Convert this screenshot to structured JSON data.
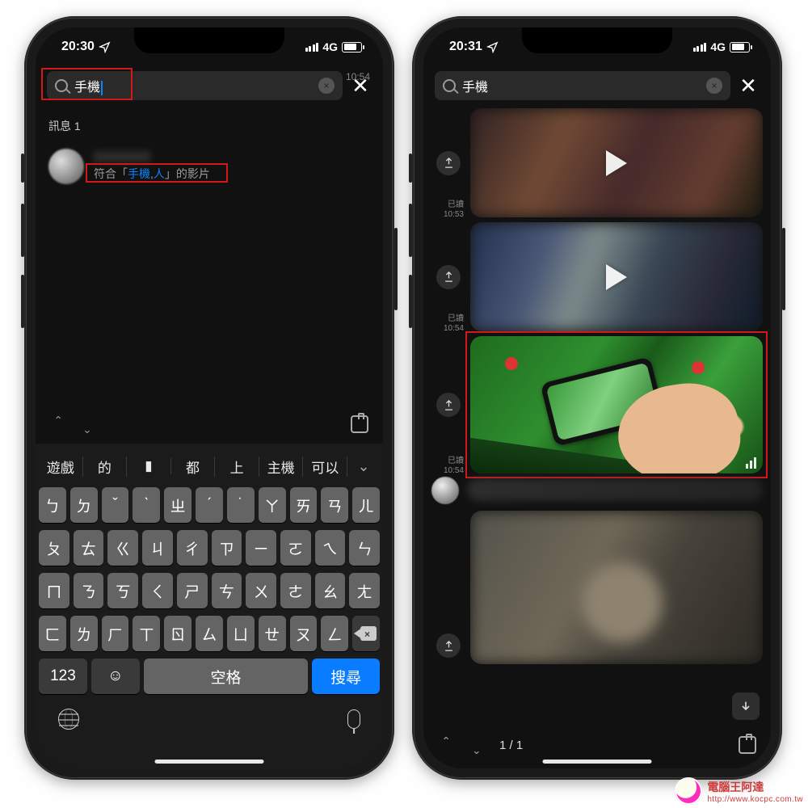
{
  "status": {
    "time_left": "20:30",
    "time_right": "20:31",
    "net": "4G"
  },
  "search": {
    "query": "手機",
    "clear": "×",
    "close": "✕"
  },
  "left": {
    "section": "訊息 1",
    "result": {
      "time": "10:54",
      "pre": "符合「",
      "hl1": "手機",
      "mid": ",",
      "hl2": "人",
      "post": "」的影片"
    },
    "suggestions": [
      "遊戲",
      "的",
      "▮",
      "都",
      "上",
      "主機",
      "可以"
    ],
    "rows": [
      [
        "ㄅ",
        "ㄉ",
        "ˇ",
        "ˋ",
        "ㄓ",
        "ˊ",
        "˙",
        "ㄚ",
        "ㄞ",
        "ㄢ",
        "ㄦ"
      ],
      [
        "ㄆ",
        "ㄊ",
        "ㄍ",
        "ㄐ",
        "ㄔ",
        "ㄗ",
        "ㄧ",
        "ㄛ",
        "ㄟ",
        "ㄣ"
      ],
      [
        "ㄇ",
        "ㄋ",
        "ㄎ",
        "ㄑ",
        "ㄕ",
        "ㄘ",
        "ㄨ",
        "ㄜ",
        "ㄠ",
        "ㄤ"
      ],
      [
        "ㄈ",
        "ㄌ",
        "ㄏ",
        "ㄒ",
        "ㄖ",
        "ㄙ",
        "ㄩ",
        "ㄝ",
        "ㄡ",
        "ㄥ"
      ]
    ],
    "numKey": "123",
    "space": "空格",
    "searchKey": "搜尋"
  },
  "right": {
    "items": [
      {
        "read": "已讀",
        "time": "10:53"
      },
      {
        "read": "已讀",
        "time": "10:54"
      },
      {
        "read": "已讀",
        "time": "10:54"
      }
    ],
    "counter": "1 / 1"
  },
  "watermark": {
    "title": "電腦王阿達",
    "url": "http://www.kocpc.com.tw"
  }
}
